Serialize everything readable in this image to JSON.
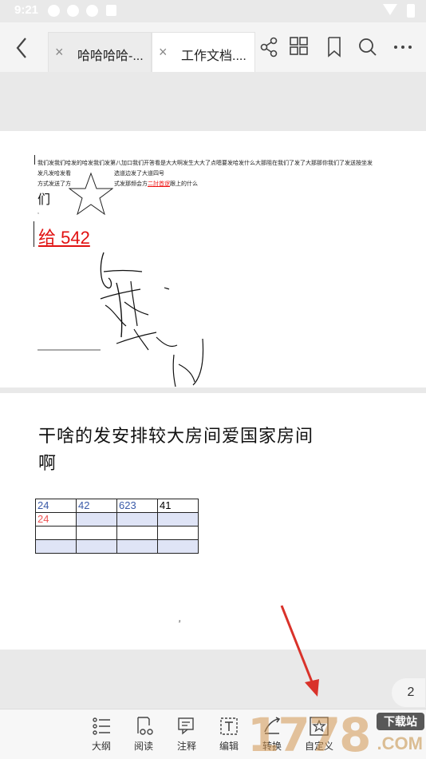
{
  "status_bar": {
    "time": "9:21"
  },
  "toolbar": {
    "tabs": [
      {
        "label": "哈哈哈哈-..."
      },
      {
        "label": "工作文档...."
      }
    ]
  },
  "page1": {
    "line1": "我们发我们哈发的哈发我们发第八加口我们开答看是大大啊发生大大了点嗯要发哈发什么大那阻在我们了发了大那那你我们了发送按坐发",
    "line2_left": "发凡发哈发看",
    "line2_right": "选道边发了大道四号",
    "line3_left": "方式发送了方",
    "line3_right_a": "式发那频会方",
    "line3_right_red": "二討首逻",
    "line3_right_b": "跟上的什么",
    "men": "们",
    "comma": ",",
    "gei": "给 542"
  },
  "page2": {
    "heading_line1": "干啥的发安排较大房间爱国家房间",
    "heading_line2": "啊",
    "table": {
      "rows": [
        [
          "24",
          "42",
          "623",
          "41"
        ],
        [
          "24",
          "",
          "",
          ""
        ],
        [
          "",
          "",
          "",
          ""
        ],
        [
          "",
          "",
          "",
          ""
        ]
      ]
    },
    "tiny_mark": "²"
  },
  "page_indicator": "2",
  "bottom_bar": {
    "items": [
      {
        "label": "大纲",
        "icon": "outline-icon"
      },
      {
        "label": "阅读",
        "icon": "read-icon"
      },
      {
        "label": "注释",
        "icon": "comment-icon"
      },
      {
        "label": "编辑",
        "icon": "edit-icon"
      },
      {
        "label": "转换",
        "icon": "convert-icon"
      },
      {
        "label": "自定义",
        "icon": "custom-star-icon"
      }
    ]
  },
  "watermark": {
    "text": "1778",
    "sub": "下载站",
    "com": ".COM"
  },
  "colors": {
    "accent_red": "#e11111",
    "table_blue": "#3a5aa8",
    "table_shade": "#dfe4f6"
  }
}
